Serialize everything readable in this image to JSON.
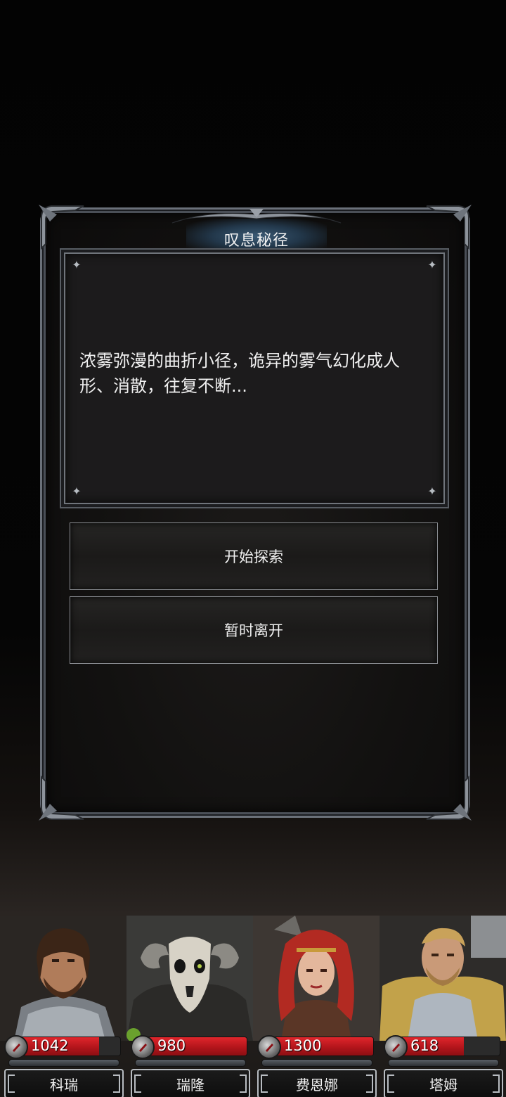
{
  "event": {
    "title": "叹息秘径",
    "description": "浓雾弥漫的曲折小径，诡异的雾气幻化成人形、消散，往复不断...",
    "choices": [
      "开始探索",
      "暂时离开"
    ]
  },
  "party": [
    {
      "name": "科瑞",
      "hp": "1042",
      "hp_fraction": 0.8,
      "portrait": "bearded-warrior-portrait"
    },
    {
      "name": "瑞隆",
      "hp": "980",
      "hp_fraction": 1.0,
      "portrait": "goat-skull-shaman-portrait"
    },
    {
      "name": "费恩娜",
      "hp": "1300",
      "hp_fraction": 1.0,
      "portrait": "red-haired-warrior-woman-portrait"
    },
    {
      "name": "塔姆",
      "hp": "618",
      "hp_fraction": 0.66,
      "portrait": "armored-paladin-portrait"
    }
  ],
  "colors": {
    "hp_red": "#c41a20",
    "panel_border": "#6b717a",
    "title_glow": "#3b5a75"
  },
  "icons": {
    "hp": "blood-drop-icon",
    "desc_corner": "sparkle-icon"
  }
}
